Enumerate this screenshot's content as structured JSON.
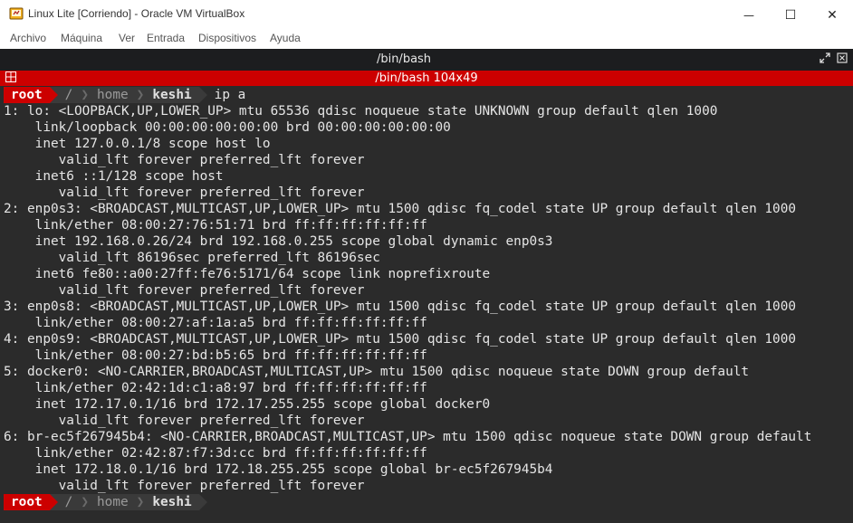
{
  "window": {
    "title": "Linux Lite [Corriendo] - Oracle VM VirtualBox",
    "minimize_glyph": "—",
    "maximize_glyph": "☐",
    "close_glyph": "✕"
  },
  "menubar": {
    "items": [
      "Archivo",
      "Máquina",
      "Ver",
      "Entrada",
      "Dispositivos",
      "Ayuda"
    ]
  },
  "terminal": {
    "header_title": "/bin/bash",
    "tab_label": "/bin/bash 104x49",
    "prompt": {
      "user": "root",
      "sep": "/",
      "dir1": "home",
      "dir2": "keshi"
    },
    "command": "ip a",
    "output": [
      "1: lo: <LOOPBACK,UP,LOWER_UP> mtu 65536 qdisc noqueue state UNKNOWN group default qlen 1000",
      "    link/loopback 00:00:00:00:00:00 brd 00:00:00:00:00:00",
      "    inet 127.0.0.1/8 scope host lo",
      "       valid_lft forever preferred_lft forever",
      "    inet6 ::1/128 scope host",
      "       valid_lft forever preferred_lft forever",
      "2: enp0s3: <BROADCAST,MULTICAST,UP,LOWER_UP> mtu 1500 qdisc fq_codel state UP group default qlen 1000",
      "    link/ether 08:00:27:76:51:71 brd ff:ff:ff:ff:ff:ff",
      "    inet 192.168.0.26/24 brd 192.168.0.255 scope global dynamic enp0s3",
      "       valid_lft 86196sec preferred_lft 86196sec",
      "    inet6 fe80::a00:27ff:fe76:5171/64 scope link noprefixroute",
      "       valid_lft forever preferred_lft forever",
      "3: enp0s8: <BROADCAST,MULTICAST,UP,LOWER_UP> mtu 1500 qdisc fq_codel state UP group default qlen 1000",
      "    link/ether 08:00:27:af:1a:a5 brd ff:ff:ff:ff:ff:ff",
      "4: enp0s9: <BROADCAST,MULTICAST,UP,LOWER_UP> mtu 1500 qdisc fq_codel state UP group default qlen 1000",
      "    link/ether 08:00:27:bd:b5:65 brd ff:ff:ff:ff:ff:ff",
      "5: docker0: <NO-CARRIER,BROADCAST,MULTICAST,UP> mtu 1500 qdisc noqueue state DOWN group default",
      "    link/ether 02:42:1d:c1:a8:97 brd ff:ff:ff:ff:ff:ff",
      "    inet 172.17.0.1/16 brd 172.17.255.255 scope global docker0",
      "       valid_lft forever preferred_lft forever",
      "6: br-ec5f267945b4: <NO-CARRIER,BROADCAST,MULTICAST,UP> mtu 1500 qdisc noqueue state DOWN group default",
      "    link/ether 02:42:87:f7:3d:cc brd ff:ff:ff:ff:ff:ff",
      "    inet 172.18.0.1/16 brd 172.18.255.255 scope global br-ec5f267945b4",
      "       valid_lft forever preferred_lft forever"
    ]
  },
  "colors": {
    "accent_red": "#cc0000",
    "terminal_bg": "#2b2b2b",
    "terminal_fg": "#e5e5e5"
  }
}
